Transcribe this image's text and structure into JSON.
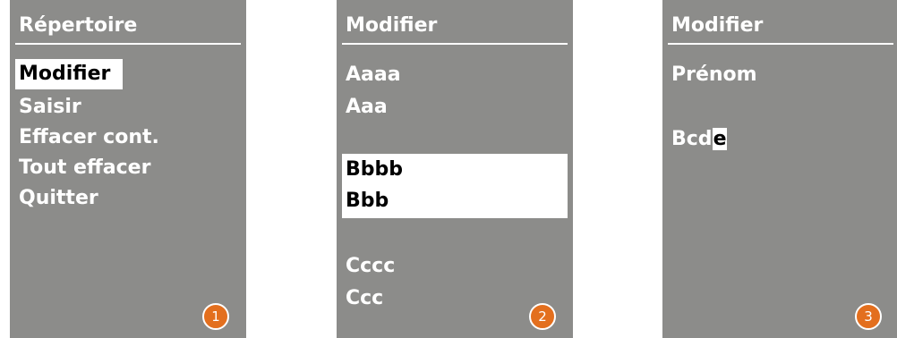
{
  "screens": [
    {
      "title": "Répertoire",
      "items": [
        "Modifier",
        "Saisir",
        "Effacer cont.",
        "Tout effacer",
        "Quitter"
      ],
      "selected_item": "Modifier",
      "step": "1"
    },
    {
      "title": "Modifier",
      "entries": [
        {
          "line1": "Aaaa",
          "line2": "Aaa"
        },
        {
          "line1": "Bbbb",
          "line2": "Bbb"
        },
        {
          "line1": "Cccc",
          "line2": "Ccc"
        }
      ],
      "selected_entry": "Bbbb",
      "step": "2"
    },
    {
      "title": "Modifier",
      "field_label": "Prénom",
      "field_value_prefix": "Bcd",
      "field_cursor_char": "e",
      "step": "3"
    }
  ],
  "colors": {
    "panel_bg": "#8c8c8a",
    "text": "#ffffff",
    "highlight_bg": "#ffffff",
    "highlight_text": "#000000",
    "badge": "#e36f1e"
  }
}
